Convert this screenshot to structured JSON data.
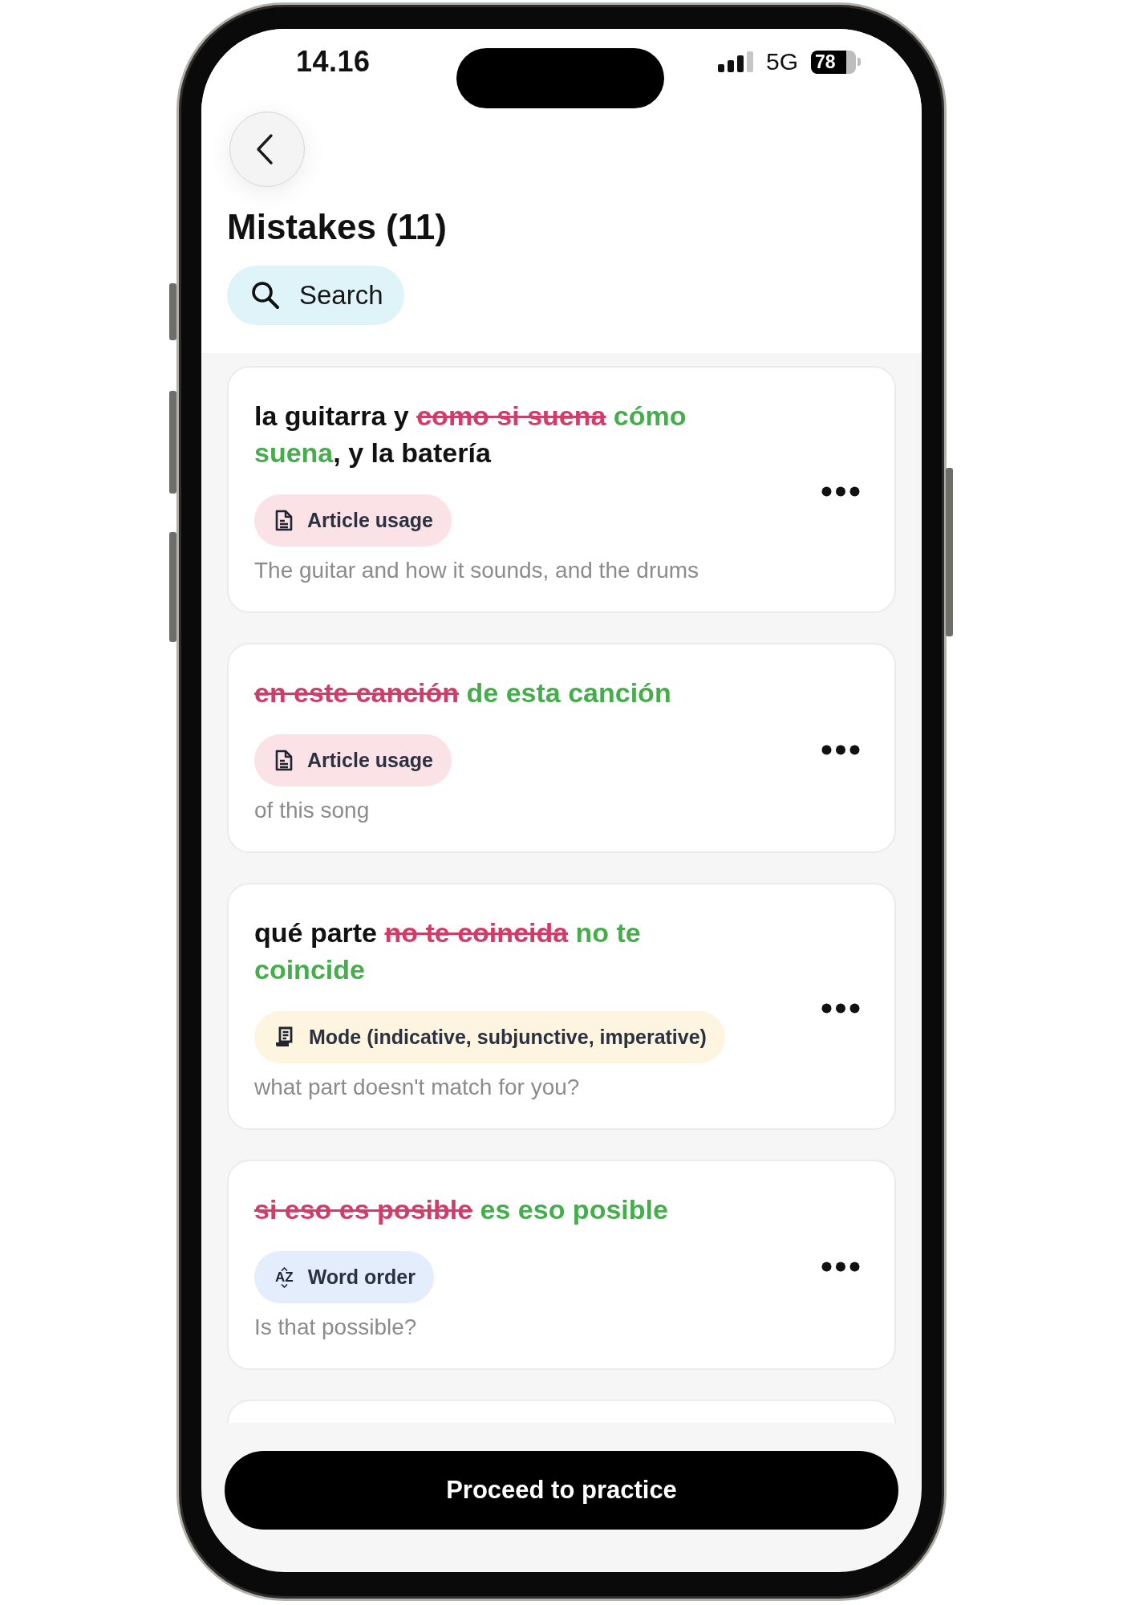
{
  "status_bar": {
    "time": "14.16",
    "network": "5G",
    "battery": "78"
  },
  "header": {
    "title": "Mistakes (11)",
    "search": {
      "label": "Search"
    }
  },
  "mistakes": [
    {
      "segments": [
        {
          "kind": "plain",
          "text": "la guitarra y "
        },
        {
          "kind": "wrong",
          "text": "como si suena"
        },
        {
          "kind": "correct",
          "text": " cómo suena"
        },
        {
          "kind": "plain",
          "text": ", y la batería"
        }
      ],
      "tag": {
        "kind": "article",
        "label": "Article usage"
      },
      "translation": "The guitar and how it sounds, and the drums"
    },
    {
      "segments": [
        {
          "kind": "wrong",
          "text": "en este canción"
        },
        {
          "kind": "correct",
          "text": " de esta canción"
        }
      ],
      "tag": {
        "kind": "article",
        "label": "Article usage"
      },
      "translation": "of this song"
    },
    {
      "segments": [
        {
          "kind": "plain",
          "text": "qué parte "
        },
        {
          "kind": "wrong",
          "text": "no te coincida"
        },
        {
          "kind": "correct",
          "text": " no te coincide"
        }
      ],
      "tag": {
        "kind": "mode",
        "label": "Mode (indicative, subjunctive, imperative)"
      },
      "translation": "what part doesn't match for you?"
    },
    {
      "segments": [
        {
          "kind": "wrong",
          "text": "si eso es posible"
        },
        {
          "kind": "correct",
          "text": " es eso posible"
        }
      ],
      "tag": {
        "kind": "word_order",
        "label": "Word order",
        "icon_text": "AZ"
      },
      "translation": "Is that possible?"
    }
  ],
  "footer": {
    "button": "Proceed to practice"
  }
}
